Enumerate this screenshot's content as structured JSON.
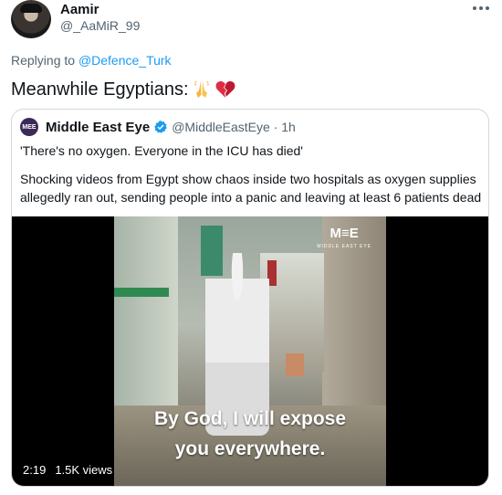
{
  "user": {
    "display_name": "Aamir",
    "handle": "@_AaMiR_99"
  },
  "reply": {
    "prefix": "Replying to",
    "mention": "@Defence_Turk"
  },
  "tweet": {
    "text": "Meanwhile Egyptians:",
    "emojis": [
      "folded-hands-icon",
      "broken-heart-icon"
    ]
  },
  "quote": {
    "logo_text": "MEE",
    "name": "Middle East Eye",
    "handle": "@MiddleEastEye · 1h",
    "line1": "'There's no oxygen. Everyone in the ICU has died'",
    "line2": "Shocking videos from Egypt show chaos inside two hospitals as oxygen supplies allegedly ran out, sending people into a panic and leaving at least 6 patients dead",
    "video": {
      "brand": "M≡E",
      "brand_sub": "MIDDLE EAST EYE",
      "caption_line1": "By God, I will expose",
      "caption_line2": "you everywhere.",
      "duration": "2:19",
      "views": "1.5K views"
    }
  },
  "colors": {
    "text": "#0f1419",
    "secondary": "#536471",
    "accent": "#1d9bf0",
    "border": "#cfd9de"
  }
}
